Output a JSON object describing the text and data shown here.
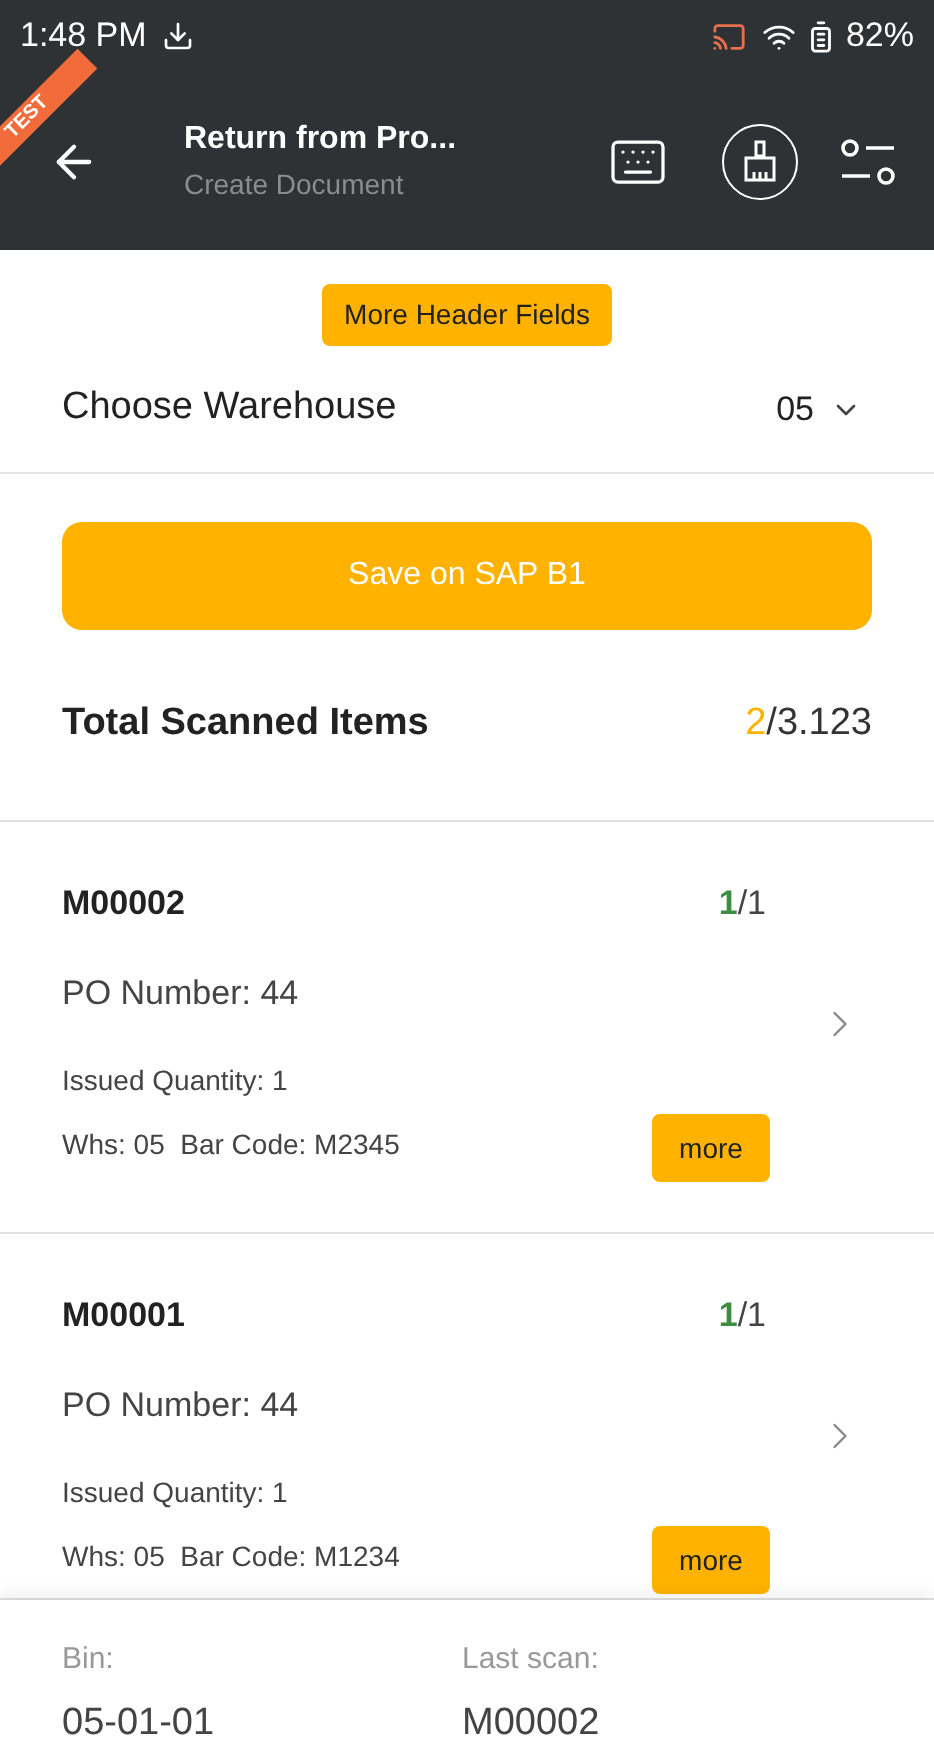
{
  "status_bar": {
    "time": "1:48 PM",
    "battery": "82%"
  },
  "ribbon": "TEST",
  "app_bar": {
    "title": "Return from Pro...",
    "subtitle": "Create Document"
  },
  "header_fields_button": "More Header Fields",
  "warehouse": {
    "label": "Choose Warehouse",
    "value": "05"
  },
  "save_button": "Save on SAP B1",
  "total": {
    "label": "Total Scanned Items",
    "scanned": "2",
    "total": "/3.123"
  },
  "items": [
    {
      "code": "M00002",
      "scanned": "1",
      "total": "/1",
      "po": "PO Number: 44",
      "issued": "Issued Quantity: 1",
      "details": "Whs: 05  Bar Code: M2345",
      "more": "more"
    },
    {
      "code": "M00001",
      "scanned": "1",
      "total": "/1",
      "po": "PO Number: 44",
      "issued": "Issued Quantity: 1",
      "details": "Whs: 05  Bar Code: M1234",
      "more": "more"
    }
  ],
  "footer": {
    "bin_label": "Bin:",
    "bin": "05-01-01",
    "last_label": "Last scan:",
    "last": "M00002"
  }
}
